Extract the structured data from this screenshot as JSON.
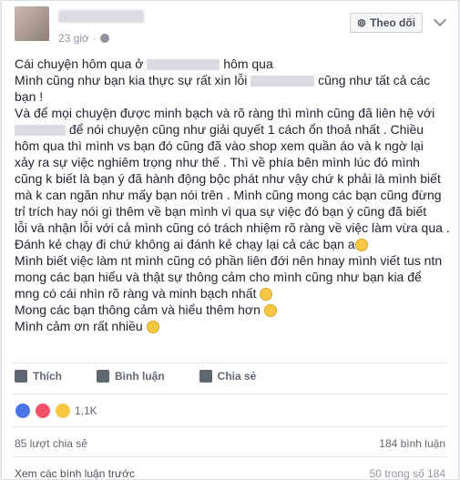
{
  "post": {
    "time": "23 giờ",
    "follow_label": "Theo dõi",
    "line1a": "Cái chuyện hôm qua ở",
    "line1b": "hôm qua",
    "line2a": "Mình cũng như bạn kia thực sự rất xin lỗi",
    "line2b": "cũng như tất cả các",
    "line3": "bạn !",
    "line4": "Và để mọi chuyện được minh bạch và rõ ràng thì mình cũng đã liên hệ với",
    "line5b": "để nói chuyện cũng như giải quyết 1 cách ổn thoả nhất . Chiều",
    "line6": "hôm qua thì mình vs bạn đó cũng đã vào shop xem quần áo và k ngờ lại",
    "line7": "xảy ra sự việc nghiêm trọng như thế . Thì về phía bên mình lúc đó mình",
    "line8": "cũng k biết là bạn ý đã hành động bộc phát như vậy chứ k phải là mình biết",
    "line9": "mà k can ngăn như mấy bạn nói trên . Mình cũng mong các bạn cũng đừng",
    "line10": "trỉ trích hay nói gì thêm về bạn mình vì qua sự việc đó bạn ý cũng đã biết",
    "line11": "lỗi và nhận lỗi với cả mình cũng có trách nhiệm rõ ràng về việc làm vừa qua .",
    "line12": "Đánh kẻ chạy đi chứ không ai đánh kẻ chạy lại cả các bạn a",
    "line13": "Mình biết việc làm nt mình cũng có phần liên đới nên hnay mình viết tus ntn",
    "line14": "mong các bạn hiểu và thật sự thông cảm cho mình cũng như bạn kia để",
    "line15": "mng có cái nhìn rõ ràng và minh bạch nhất",
    "line16": "Mong các bạn thông cảm và hiểu thêm hơn",
    "line17": "Mình cảm ơn rất nhiều"
  },
  "actions": {
    "like": "Thích",
    "comment": "Bình luận",
    "share": "Chia sẻ"
  },
  "reactions": {
    "count": "1,1K"
  },
  "stats": {
    "shares": "85 lượt chia sẻ",
    "comments": "184 bình luận"
  },
  "footer": {
    "view_more": "Xem các bình luận trước",
    "pager": "50 trong số 184"
  }
}
